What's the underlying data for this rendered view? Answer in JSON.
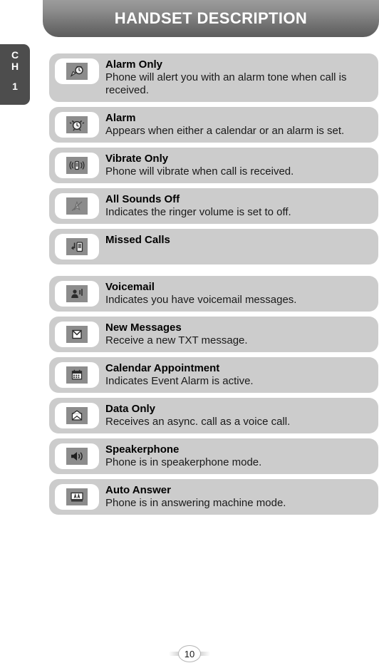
{
  "header": {
    "title": "HANDSET DESCRIPTION"
  },
  "chapter_tab": {
    "line1": "C",
    "line2": "H",
    "number": "1"
  },
  "rows": [
    {
      "icon": "alarm-only-icon",
      "title": "Alarm Only",
      "desc": "Phone will alert you with an alarm tone when call is received."
    },
    {
      "icon": "alarm-clock-icon",
      "title": "Alarm",
      "desc": "Appears when either a calendar or an alarm is set."
    },
    {
      "icon": "vibrate-icon",
      "title": "Vibrate Only",
      "desc": "Phone will vibrate when call is received."
    },
    {
      "icon": "all-sounds-off-icon",
      "title": "All Sounds Off",
      "desc": "Indicates the ringer volume is set to off."
    },
    {
      "icon": "missed-calls-icon",
      "title": "Missed Calls",
      "desc": ""
    },
    {
      "icon": "voicemail-icon",
      "title": "Voicemail",
      "desc": "Indicates you have voicemail messages."
    },
    {
      "icon": "new-messages-icon",
      "title": "New Messages",
      "desc": "Receive a new TXT message."
    },
    {
      "icon": "calendar-icon",
      "title": "Calendar Appointment",
      "desc": "Indicates Event Alarm is active."
    },
    {
      "icon": "data-only-icon",
      "title": "Data Only",
      "desc": "Receives an async. call as a voice call."
    },
    {
      "icon": "speakerphone-icon",
      "title": "Speakerphone",
      "desc": "Phone is in speakerphone mode."
    },
    {
      "icon": "auto-answer-icon",
      "title": "Auto Answer",
      "desc": "Phone is in answering machine mode."
    }
  ],
  "footer": {
    "page_number": "10"
  },
  "colors": {
    "row_background": "#cccccc",
    "icon_badge": "#ffffff",
    "icon_tile": "#8c8c8c",
    "chapter_tab": "#4d4d4d",
    "header_dark": "#5d5d5d",
    "header_light": "#9c9c9c"
  }
}
